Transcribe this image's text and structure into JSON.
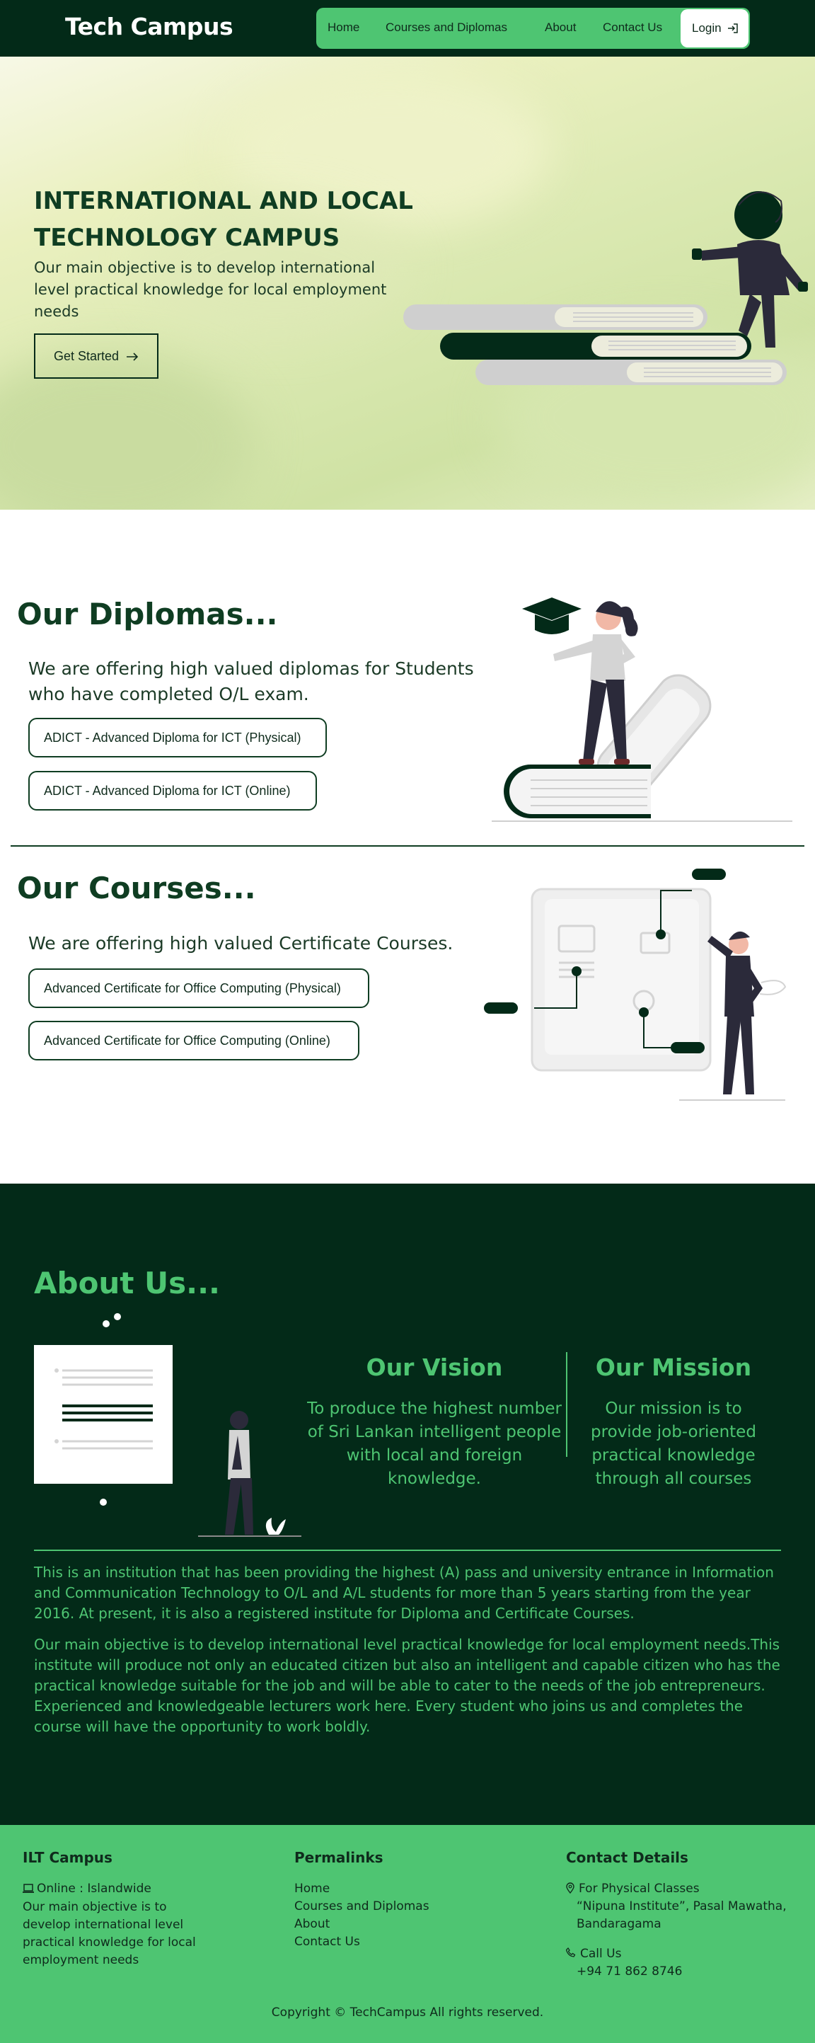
{
  "nav": {
    "brand": "Tech Campus",
    "items": [
      {
        "label": "Home"
      },
      {
        "label": "Courses and Diplomas"
      },
      {
        "label": "About"
      },
      {
        "label": "Contact Us"
      }
    ],
    "login_label": "Login"
  },
  "hero": {
    "title": "INTERNATIONAL AND LOCAL TECHNOLOGY CAMPUS",
    "subtitle": "Our main objective is to develop international level practical knowledge for local employment needs",
    "cta_label": "Get Started"
  },
  "diplomas": {
    "title": "Our Diplomas...",
    "subtitle": "We are offering high valued diplomas for Students who have completed O/L exam.",
    "items": [
      {
        "label": "ADICT - Advanced Diploma for ICT (Physical)"
      },
      {
        "label": "ADICT - Advanced Diploma for ICT (Online)"
      }
    ]
  },
  "courses": {
    "title": "Our Courses...",
    "subtitle": "We are offering high valued Certificate Courses.",
    "items": [
      {
        "label": "Advanced Certificate for Office Computing (Physical)"
      },
      {
        "label": "Advanced Certificate for Office Computing (Online)"
      }
    ]
  },
  "about": {
    "title": "About Us...",
    "vision_title": "Our Vision",
    "vision_text": "To produce the highest number of Sri Lankan intelligent people with local and foreign knowledge.",
    "mission_title": "Our Mission",
    "mission_text": "Our mission is to provide job-oriented practical knowledge through all courses",
    "paragraph1": "This is an institution that has been providing the highest (A) pass and university entrance in Information and Communication Technology to O/L and A/L students for more than 5 years starting from the year 2016. At present, it is also a registered institute for Diploma and Certificate Courses.",
    "paragraph2": "Our main objective is to develop international level practical knowledge for local employment needs.This institute will produce not only an educated citizen but also an intelligent and capable citizen who has the practical knowledge suitable for the job and will be able to cater to the needs of the job entrepreneurs. Experienced and knowledgeable lecturers work here. Every student who joins us and completes the course will have the opportunity to work boldly."
  },
  "footer": {
    "col1_title": "ILT Campus",
    "online_label": "Online : Islandwide",
    "col1_text": "Our main objective is to develop international level practical knowledge for local employment needs",
    "col2_title": "Permalinks",
    "links": [
      {
        "label": "Home"
      },
      {
        "label": "Courses and Diplomas"
      },
      {
        "label": "About"
      },
      {
        "label": "Contact Us"
      }
    ],
    "col3_title": "Contact Details",
    "physical_label": "For Physical Classes",
    "address": "“Nipuna Institute”, Pasal Mawatha, Bandaragama",
    "call_label": "Call Us",
    "phone": "+94 71 862 8746",
    "copyright": "Copyright © TechCampus All rights reserved."
  },
  "colors": {
    "dark_green": "#032a18",
    "accent_green": "#4ec572",
    "text_dark": "#0f2b1c"
  },
  "icons": [
    "login-icon",
    "arrow-right-icon",
    "laptop-icon",
    "location-pin-icon",
    "phone-icon"
  ]
}
